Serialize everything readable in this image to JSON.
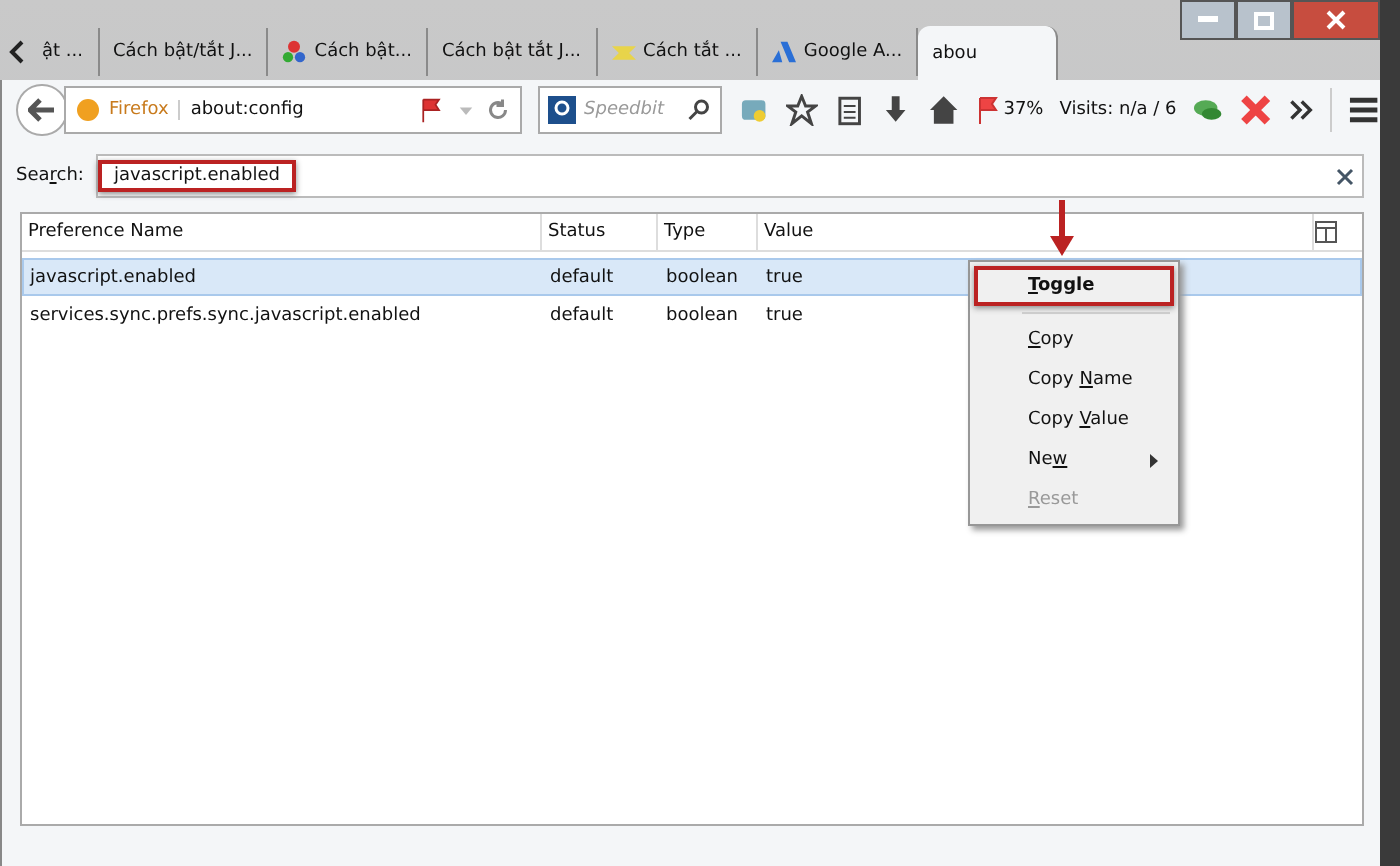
{
  "tabs": [
    {
      "label": "ật ...",
      "selected": false
    },
    {
      "label": "Cách bật/tắt J...",
      "selected": false
    },
    {
      "label": "Cách bật...",
      "selected": false
    },
    {
      "label": "Cách bật tắt J...",
      "selected": false
    },
    {
      "label": "Cách tắt ...",
      "selected": false
    },
    {
      "label": "Google A...",
      "selected": false
    },
    {
      "label": "abou",
      "selected": true
    }
  ],
  "navbar": {
    "brand": "Firefox",
    "url": "about:config",
    "search_placeholder": "Speedbit",
    "percent": "37%",
    "visits": "Visits: n/a / 6"
  },
  "filter": {
    "label_parts": [
      "Sea",
      "r",
      "ch:"
    ],
    "value": "javascript.enabled"
  },
  "table": {
    "columns": [
      "Preference Name",
      "Status",
      "Type",
      "Value"
    ],
    "rows": [
      {
        "cells": [
          "javascript.enabled",
          "default",
          "boolean",
          "true"
        ],
        "selected": true
      },
      {
        "cells": [
          "services.sync.prefs.sync.javascript.enabled",
          "default",
          "boolean",
          "true"
        ],
        "selected": false
      }
    ]
  },
  "context_menu": {
    "items": [
      {
        "kind": "item",
        "parts": {
          "key": "T",
          "after": "oggle"
        },
        "highlighted": true,
        "disabled": false
      },
      {
        "kind": "separator"
      },
      {
        "kind": "item",
        "parts": {
          "key": "C",
          "after": "opy"
        },
        "highlighted": false,
        "disabled": false
      },
      {
        "kind": "item",
        "parts": {
          "before": "Copy ",
          "key": "N",
          "after": "ame"
        },
        "highlighted": false,
        "disabled": false
      },
      {
        "kind": "item",
        "parts": {
          "before": "Copy ",
          "key": "V",
          "after": "alue"
        },
        "highlighted": false,
        "disabled": false
      },
      {
        "kind": "item",
        "parts": {
          "before": "Ne",
          "key": "w"
        },
        "highlighted": false,
        "disabled": false,
        "submenu": true
      },
      {
        "kind": "item",
        "parts": {
          "key": "R",
          "after": "eset"
        },
        "highlighted": false,
        "disabled": true
      }
    ]
  }
}
